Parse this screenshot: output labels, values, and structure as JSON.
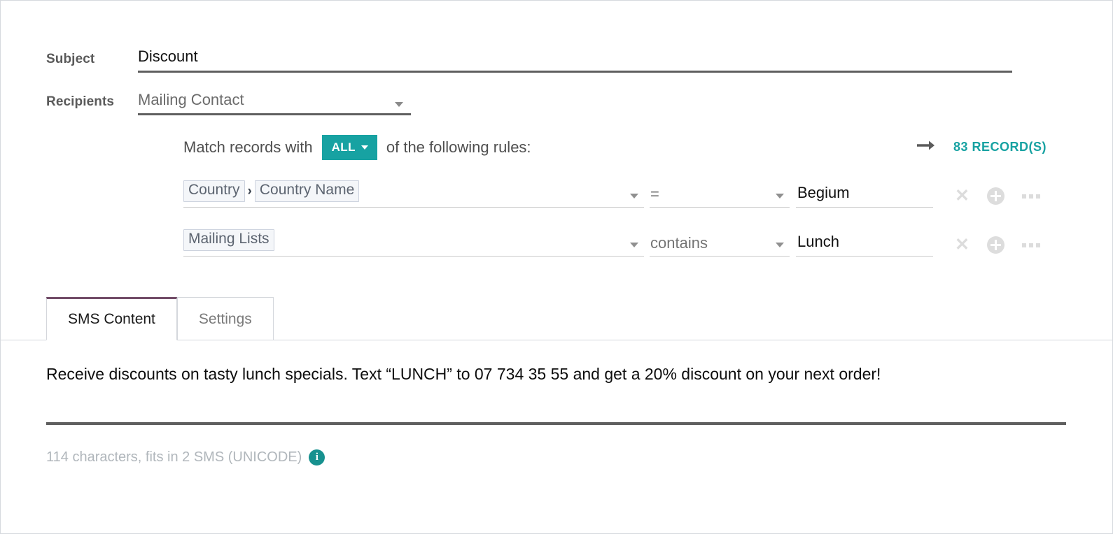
{
  "form": {
    "subject": {
      "label": "Subject",
      "value": "Discount",
      "placeholder": "Subject"
    },
    "recipients": {
      "label": "Recipients",
      "value": "Mailing Contact",
      "options": [
        "Mailing Contact"
      ]
    }
  },
  "filter": {
    "match_prefix": "Match records with",
    "match_suffix": "of the following rules:",
    "all_badge": "ALL",
    "records_count": "83 RECORD(S)",
    "arrow_icon": "arrow-right-icon",
    "rules": [
      {
        "field_tokens": [
          "Country",
          "Country Name"
        ],
        "token_separator": "›",
        "operator": "=",
        "value": "Begium",
        "delete_icon": "close-icon",
        "add_icon": "plus-circle-icon",
        "more_icon": "ellipsis-icon"
      },
      {
        "field_tokens": [
          "Mailing Lists"
        ],
        "token_separator": "›",
        "operator": "contains",
        "value": "Lunch",
        "delete_icon": "close-icon",
        "add_icon": "plus-circle-icon",
        "more_icon": "ellipsis-icon"
      }
    ]
  },
  "tabs": [
    {
      "label": "SMS Content",
      "active": true
    },
    {
      "label": "Settings",
      "active": false
    }
  ],
  "sms": {
    "body": "Receive discounts on tasty lunch specials. Text “LUNCH” to 07 734 35 55 and get a 20% discount on your next order!",
    "char_info": "114 characters, fits in 2 SMS (UNICODE)",
    "info_icon": "info-icon",
    "info_glyph": "i"
  },
  "colors": {
    "accent_teal": "#17a2a2",
    "primary_purple": "#714b67",
    "info_teal": "#17918f",
    "underline_dark": "#5f5f5f",
    "muted_text": "#b0b6bb"
  }
}
